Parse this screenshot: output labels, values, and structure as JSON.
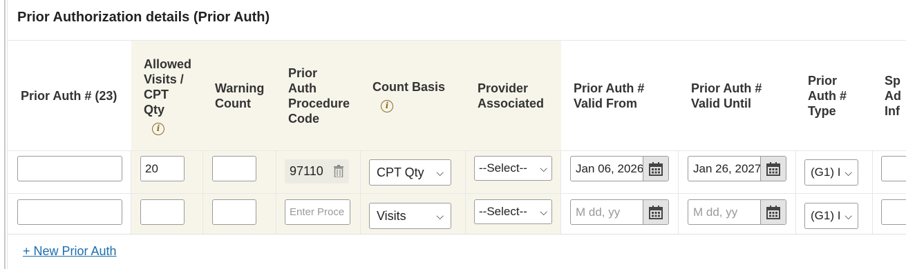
{
  "panel": {
    "title": "Prior Authorization details (Prior Auth)"
  },
  "columns": {
    "prior_auth": "Prior Auth # (23)",
    "allowed_visits": [
      "Allowed",
      "Visits /",
      "CPT",
      "Qty"
    ],
    "warning_count": [
      "Warning",
      "Count"
    ],
    "procedure_code": [
      "Prior",
      "Auth",
      "Procedure",
      "Code"
    ],
    "count_basis": "Count Basis",
    "provider": [
      "Provider",
      "Associated"
    ],
    "valid_from": [
      "Prior Auth #",
      "Valid From"
    ],
    "valid_until": [
      "Prior Auth #",
      "Valid Until"
    ],
    "auth_type": [
      "Prior",
      "Auth #",
      "Type"
    ],
    "special": [
      "Sp",
      "Ad",
      "Inf"
    ]
  },
  "info_icon": "info-icon",
  "rows": [
    {
      "prior_auth_number": "",
      "allowed_visits": "20",
      "warning_count": "",
      "procedure_code": "97110",
      "count_basis": "CPT Qty",
      "provider": "--Select--",
      "valid_from": "Jan 06, 2026",
      "valid_until": "Jan 26, 2027",
      "auth_type": "(G1) I"
    },
    {
      "prior_auth_number": "",
      "allowed_visits": "",
      "warning_count": "",
      "procedure_code_placeholder": "Enter Proce",
      "count_basis": "Visits",
      "provider": "--Select--",
      "valid_from_placeholder": "M dd, yy",
      "valid_until_placeholder": "M dd, yy",
      "auth_type": "(G1) I"
    }
  ],
  "new_link": "+ New Prior Auth",
  "colors": {
    "highlight": "#f7f5ea",
    "link": "#1a6fb0",
    "info": "#8a6b1e"
  }
}
